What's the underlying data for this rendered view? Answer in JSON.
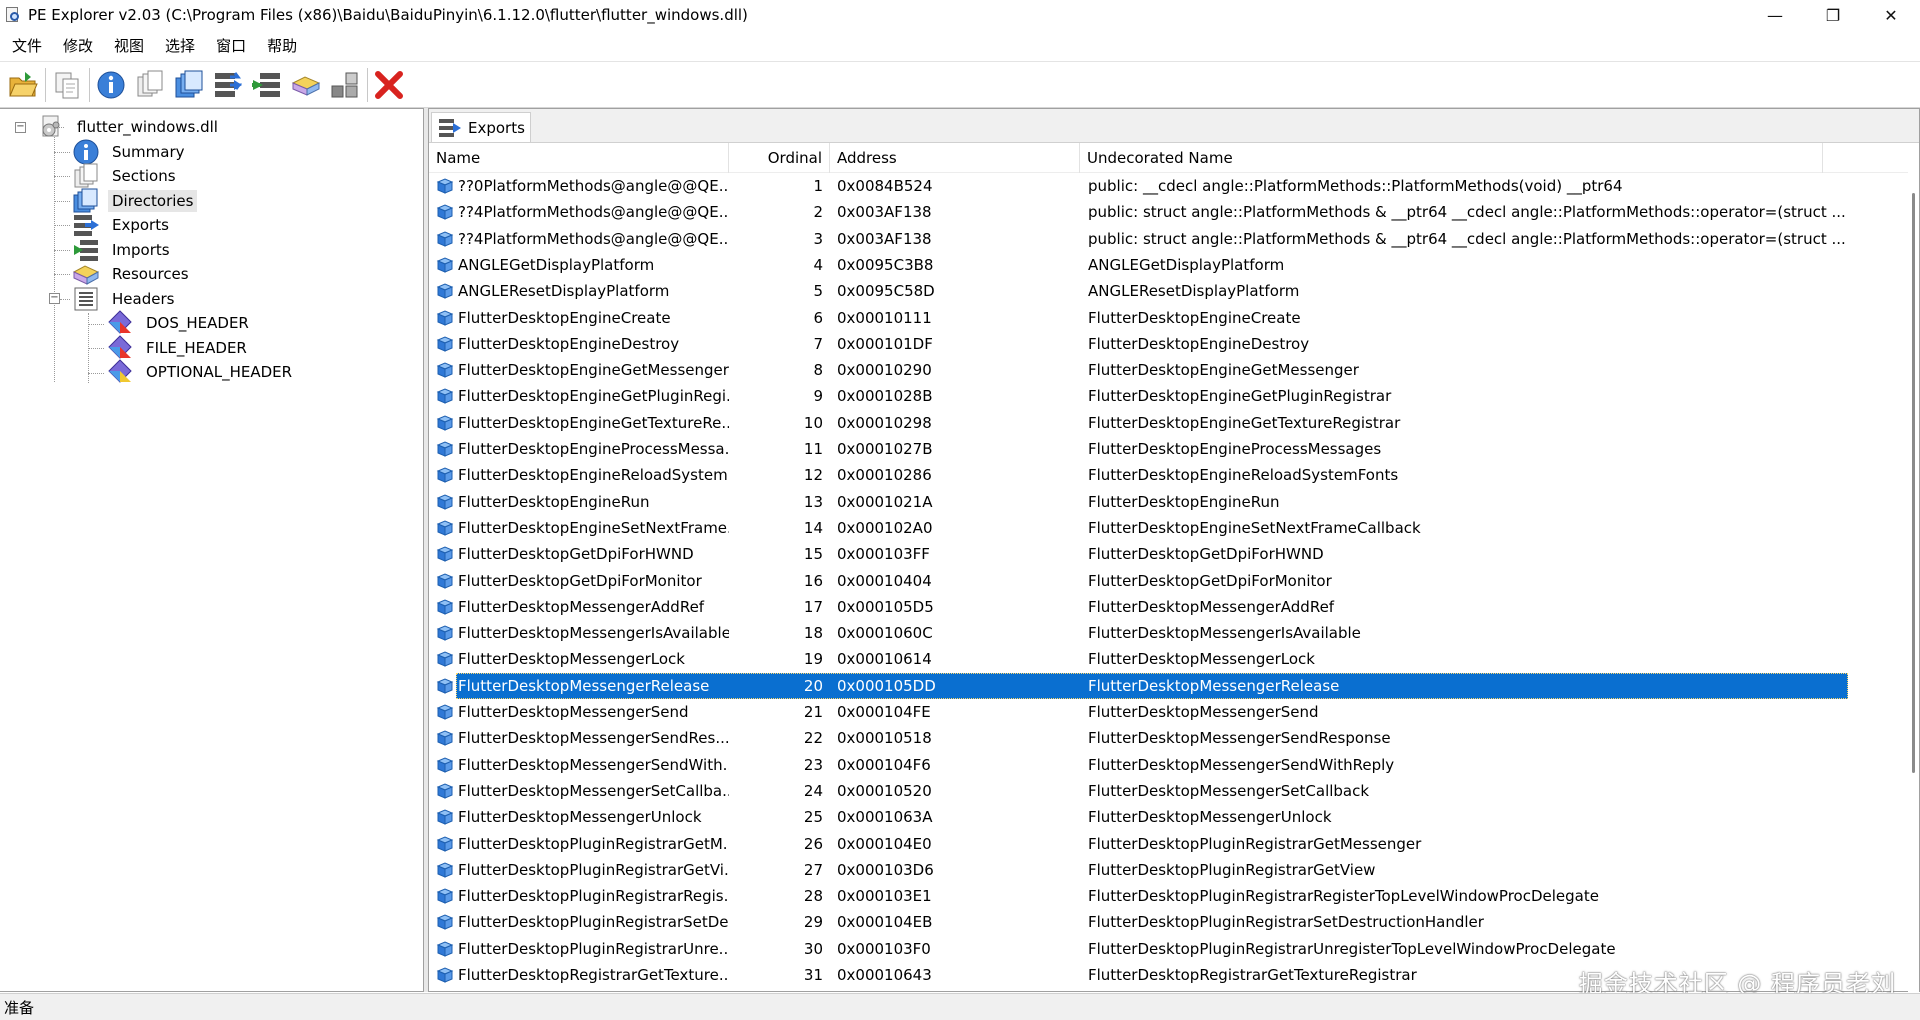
{
  "window": {
    "title": "PE Explorer v2.03 (C:\\Program Files (x86)\\Baidu\\BaiduPinyin\\6.1.12.0\\flutter\\flutter_windows.dll)",
    "minimize": "—",
    "restore": "❐",
    "close": "✕"
  },
  "menu": [
    "文件",
    "修改",
    "视图",
    "选择",
    "窗口",
    "帮助"
  ],
  "toolbar": [
    {
      "name": "open-icon"
    },
    {
      "name": "copy-icon"
    },
    {
      "name": "info-icon"
    },
    {
      "name": "sections-icon"
    },
    {
      "name": "directories-icon"
    },
    {
      "name": "exports-icon"
    },
    {
      "name": "imports-icon"
    },
    {
      "name": "resources-icon"
    },
    {
      "name": "layout-icon"
    },
    {
      "name": "close-file-icon"
    }
  ],
  "tree": {
    "root": "flutter_windows.dll",
    "items": [
      "Summary",
      "Sections",
      "Directories",
      "Exports",
      "Imports",
      "Resources",
      "Headers"
    ],
    "headers": [
      "DOS_HEADER",
      "FILE_HEADER",
      "OPTIONAL_HEADER"
    ],
    "selected": "Directories"
  },
  "tab": {
    "label": "Exports"
  },
  "columns": {
    "name": "Name",
    "ordinal": "Ordinal",
    "address": "Address",
    "undecorated": "Undecorated Name"
  },
  "rows": [
    {
      "name": "??0PlatformMethods@angle@@QE...",
      "ordinal": "1",
      "address": "0x0084B524",
      "undecorated": "public: __cdecl angle::PlatformMethods::PlatformMethods(void) __ptr64"
    },
    {
      "name": "??4PlatformMethods@angle@@QE...",
      "ordinal": "2",
      "address": "0x003AF138",
      "undecorated": "public: struct angle::PlatformMethods & __ptr64 __cdecl angle::PlatformMethods::operator=(struct ..."
    },
    {
      "name": "??4PlatformMethods@angle@@QE...",
      "ordinal": "3",
      "address": "0x003AF138",
      "undecorated": "public: struct angle::PlatformMethods & __ptr64 __cdecl angle::PlatformMethods::operator=(struct ..."
    },
    {
      "name": "ANGLEGetDisplayPlatform",
      "ordinal": "4",
      "address": "0x0095C3B8",
      "undecorated": "ANGLEGetDisplayPlatform"
    },
    {
      "name": "ANGLEResetDisplayPlatform",
      "ordinal": "5",
      "address": "0x0095C58D",
      "undecorated": "ANGLEResetDisplayPlatform"
    },
    {
      "name": "FlutterDesktopEngineCreate",
      "ordinal": "6",
      "address": "0x00010111",
      "undecorated": "FlutterDesktopEngineCreate"
    },
    {
      "name": "FlutterDesktopEngineDestroy",
      "ordinal": "7",
      "address": "0x000101DF",
      "undecorated": "FlutterDesktopEngineDestroy"
    },
    {
      "name": "FlutterDesktopEngineGetMessenger",
      "ordinal": "8",
      "address": "0x00010290",
      "undecorated": "FlutterDesktopEngineGetMessenger"
    },
    {
      "name": "FlutterDesktopEngineGetPluginRegi...",
      "ordinal": "9",
      "address": "0x0001028B",
      "undecorated": "FlutterDesktopEngineGetPluginRegistrar"
    },
    {
      "name": "FlutterDesktopEngineGetTextureRe...",
      "ordinal": "10",
      "address": "0x00010298",
      "undecorated": "FlutterDesktopEngineGetTextureRegistrar"
    },
    {
      "name": "FlutterDesktopEngineProcessMessa...",
      "ordinal": "11",
      "address": "0x0001027B",
      "undecorated": "FlutterDesktopEngineProcessMessages"
    },
    {
      "name": "FlutterDesktopEngineReloadSystem...",
      "ordinal": "12",
      "address": "0x00010286",
      "undecorated": "FlutterDesktopEngineReloadSystemFonts"
    },
    {
      "name": "FlutterDesktopEngineRun",
      "ordinal": "13",
      "address": "0x0001021A",
      "undecorated": "FlutterDesktopEngineRun"
    },
    {
      "name": "FlutterDesktopEngineSetNextFrame...",
      "ordinal": "14",
      "address": "0x000102A0",
      "undecorated": "FlutterDesktopEngineSetNextFrameCallback"
    },
    {
      "name": "FlutterDesktopGetDpiForHWND",
      "ordinal": "15",
      "address": "0x000103FF",
      "undecorated": "FlutterDesktopGetDpiForHWND"
    },
    {
      "name": "FlutterDesktopGetDpiForMonitor",
      "ordinal": "16",
      "address": "0x00010404",
      "undecorated": "FlutterDesktopGetDpiForMonitor"
    },
    {
      "name": "FlutterDesktopMessengerAddRef",
      "ordinal": "17",
      "address": "0x000105D5",
      "undecorated": "FlutterDesktopMessengerAddRef"
    },
    {
      "name": "FlutterDesktopMessengerIsAvailable",
      "ordinal": "18",
      "address": "0x0001060C",
      "undecorated": "FlutterDesktopMessengerIsAvailable"
    },
    {
      "name": "FlutterDesktopMessengerLock",
      "ordinal": "19",
      "address": "0x00010614",
      "undecorated": "FlutterDesktopMessengerLock"
    },
    {
      "name": "FlutterDesktopMessengerRelease",
      "ordinal": "20",
      "address": "0x000105DD",
      "undecorated": "FlutterDesktopMessengerRelease"
    },
    {
      "name": "FlutterDesktopMessengerSend",
      "ordinal": "21",
      "address": "0x000104FE",
      "undecorated": "FlutterDesktopMessengerSend"
    },
    {
      "name": "FlutterDesktopMessengerSendRes...",
      "ordinal": "22",
      "address": "0x00010518",
      "undecorated": "FlutterDesktopMessengerSendResponse"
    },
    {
      "name": "FlutterDesktopMessengerSendWith...",
      "ordinal": "23",
      "address": "0x000104F6",
      "undecorated": "FlutterDesktopMessengerSendWithReply"
    },
    {
      "name": "FlutterDesktopMessengerSetCallba...",
      "ordinal": "24",
      "address": "0x00010520",
      "undecorated": "FlutterDesktopMessengerSetCallback"
    },
    {
      "name": "FlutterDesktopMessengerUnlock",
      "ordinal": "25",
      "address": "0x0001063A",
      "undecorated": "FlutterDesktopMessengerUnlock"
    },
    {
      "name": "FlutterDesktopPluginRegistrarGetM...",
      "ordinal": "26",
      "address": "0x000104E0",
      "undecorated": "FlutterDesktopPluginRegistrarGetMessenger"
    },
    {
      "name": "FlutterDesktopPluginRegistrarGetVi...",
      "ordinal": "27",
      "address": "0x000103D6",
      "undecorated": "FlutterDesktopPluginRegistrarGetView"
    },
    {
      "name": "FlutterDesktopPluginRegistrarRegis...",
      "ordinal": "28",
      "address": "0x000103E1",
      "undecorated": "FlutterDesktopPluginRegistrarRegisterTopLevelWindowProcDelegate"
    },
    {
      "name": "FlutterDesktopPluginRegistrarSetDe...",
      "ordinal": "29",
      "address": "0x000104EB",
      "undecorated": "FlutterDesktopPluginRegistrarSetDestructionHandler"
    },
    {
      "name": "FlutterDesktopPluginRegistrarUnre...",
      "ordinal": "30",
      "address": "0x000103F0",
      "undecorated": "FlutterDesktopPluginRegistrarUnregisterTopLevelWindowProcDelegate"
    },
    {
      "name": "FlutterDesktopRegistrarGetTexture...",
      "ordinal": "31",
      "address": "0x00010643",
      "undecorated": "FlutterDesktopRegistrarGetTextureRegistrar"
    }
  ],
  "selected_ordinal": "20",
  "status": "准备",
  "watermark": "掘金技术社区 @ 程序员老刘",
  "colors": {
    "selection": "#0a6fd0",
    "accent": "#2a5aa8"
  }
}
